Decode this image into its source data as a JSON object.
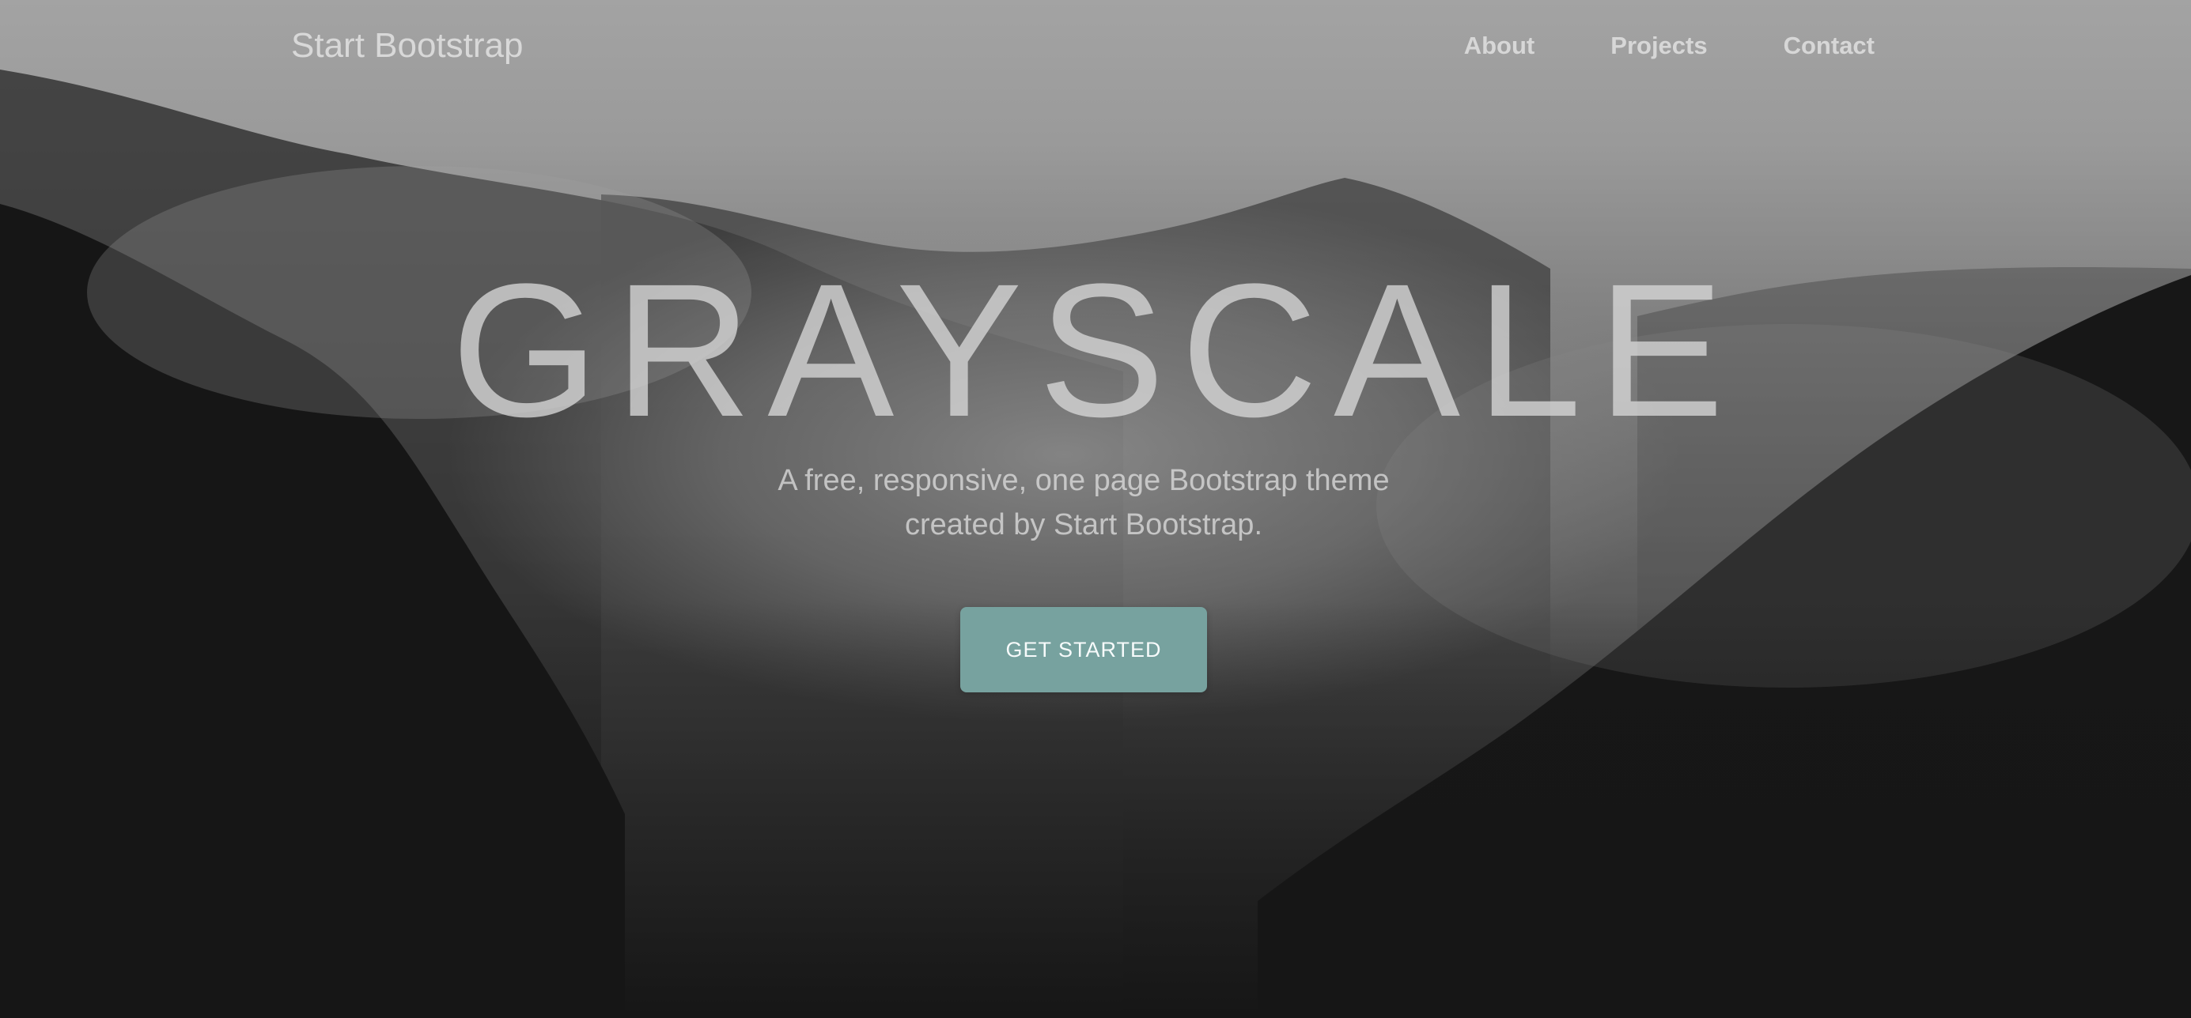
{
  "nav": {
    "brand": "Start Bootstrap",
    "links": [
      {
        "label": "About"
      },
      {
        "label": "Projects"
      },
      {
        "label": "Contact"
      }
    ]
  },
  "hero": {
    "title": "GRAYSCALE",
    "subtitle_line1": "A free, responsive, one page Bootstrap theme",
    "subtitle_line2": "created by Start Bootstrap.",
    "cta_label": "GET STARTED"
  },
  "colors": {
    "accent": "#77a29f",
    "background_dark": "#161616"
  },
  "background_image": "misty-mountain-forest"
}
